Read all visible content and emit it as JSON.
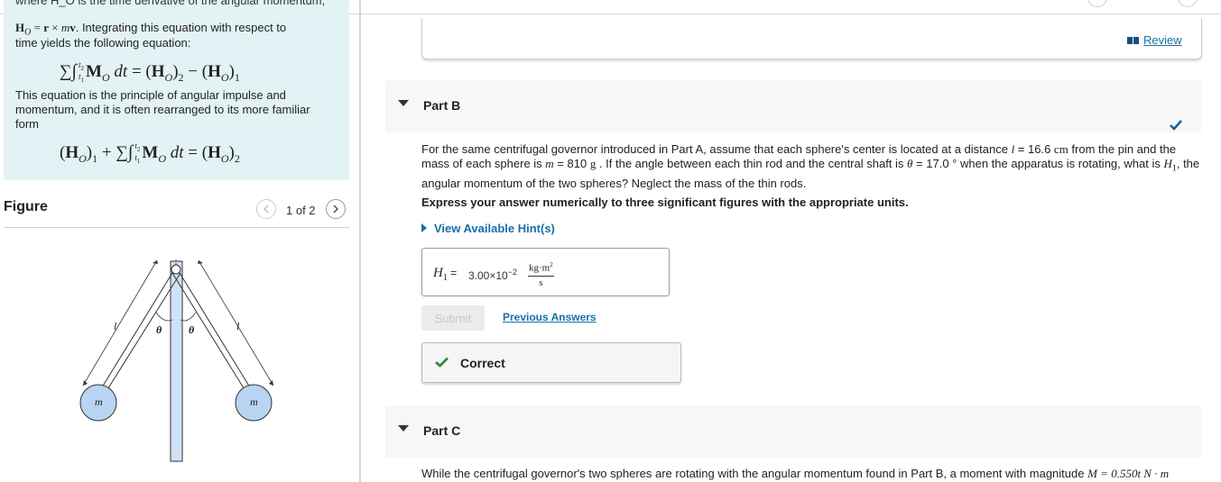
{
  "intro": {
    "cut_line": "where Ḣ_O is the time derivative of the angular momentum,",
    "line1_suffix": ". Integrating this equation with respect to",
    "line2": "time yields the following equation:",
    "para2": "This equation is the principle of angular impulse and momentum, and it is often rearranged to its more familiar form"
  },
  "figure": {
    "title": "Figure",
    "pager": "1 of 2",
    "labels": {
      "l_left": "l",
      "l_right": "l",
      "theta_left": "θ",
      "theta_right": "θ",
      "m_left": "m",
      "m_right": "m"
    }
  },
  "review": {
    "label": "Review"
  },
  "partB": {
    "title": "Part B",
    "problem": {
      "p1": "For the same centrifugal governor introduced in Part A, assume that each sphere's center is located at a distance ",
      "l_var": "l",
      "l_val": " = 16.6 ",
      "l_unit": "cm",
      "p2": " from the pin and the mass of each sphere is ",
      "m_var": "m",
      "m_val": " = 810 ",
      "m_unit": "g",
      "p3": " . If the angle between each thin rod and the central shaft is ",
      "theta": "θ",
      "theta_val": " = 17.0 °",
      "p4": " when the apparatus is rotating, what is ",
      "h_var": "H",
      "h_sub": "1",
      "p5": ", the angular momentum of the two spheres? Neglect the mass of the thin rods."
    },
    "instruction": "Express your answer numerically to three significant figures with the appropriate units.",
    "hint": "View Available Hint(s)",
    "answer": {
      "var": "H",
      "sub": "1",
      "equals": " = ",
      "mantissa": "3.00×10",
      "exponent": "−2",
      "unit_num": "kg·m",
      "unit_num_sup": "2",
      "unit_den": "s"
    },
    "submit": "Submit",
    "previous_answers": "Previous Answers",
    "result": "Correct"
  },
  "partC": {
    "title": "Part C",
    "text": "While the centrifugal governor's two spheres are rotating with the angular momentum found in Part B, a moment with magnitude ",
    "m_expr": "M = 0.550t N · m"
  },
  "colors": {
    "accent": "#1a6fa8",
    "success": "#2f8a3a",
    "intro_bg": "#e3f3f5",
    "sphere": "#b9d3f2"
  }
}
